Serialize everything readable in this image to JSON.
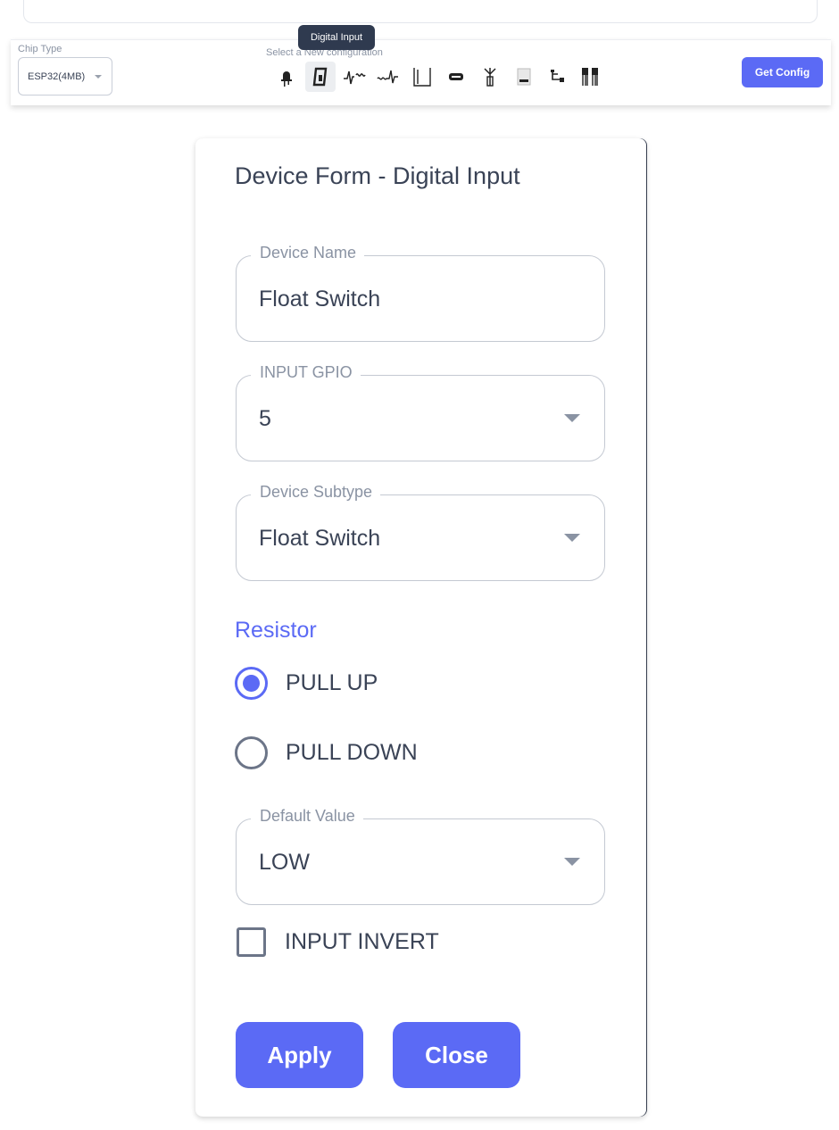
{
  "toolbar": {
    "chip_type_label": "Chip Type",
    "chip_type_value": "ESP32(4MB)",
    "config_hint": "Select a New configuration",
    "tooltip": "Digital Input",
    "device_icons": [
      "led-icon",
      "digital-input-icon",
      "analog-input-icon",
      "sensor-wave-icon",
      "pulse-icon",
      "module-icon",
      "antenna-icon",
      "bus-icon",
      "relay-icon",
      "multi-sensor-icon"
    ],
    "active_icon": "digital-input-icon",
    "get_config_label": "Get Config"
  },
  "form": {
    "title": "Device Form - Digital Input",
    "device_name": {
      "label": "Device Name",
      "value": "Float Switch"
    },
    "input_gpio": {
      "label": "INPUT GPIO",
      "value": "5"
    },
    "device_subtype": {
      "label": "Device Subtype",
      "value": "Float Switch"
    },
    "resistor": {
      "label": "Resistor",
      "options": [
        "PULL UP",
        "PULL DOWN"
      ],
      "selected": "PULL UP"
    },
    "default_value": {
      "label": "Default Value",
      "value": "LOW"
    },
    "input_invert": {
      "label": "INPUT INVERT",
      "checked": false
    },
    "apply_label": "Apply",
    "close_label": "Close"
  },
  "colors": {
    "accent": "#5b6af5",
    "text": "#3a4356",
    "muted": "#8a93a3",
    "tooltip_bg": "#2f3a4f"
  }
}
